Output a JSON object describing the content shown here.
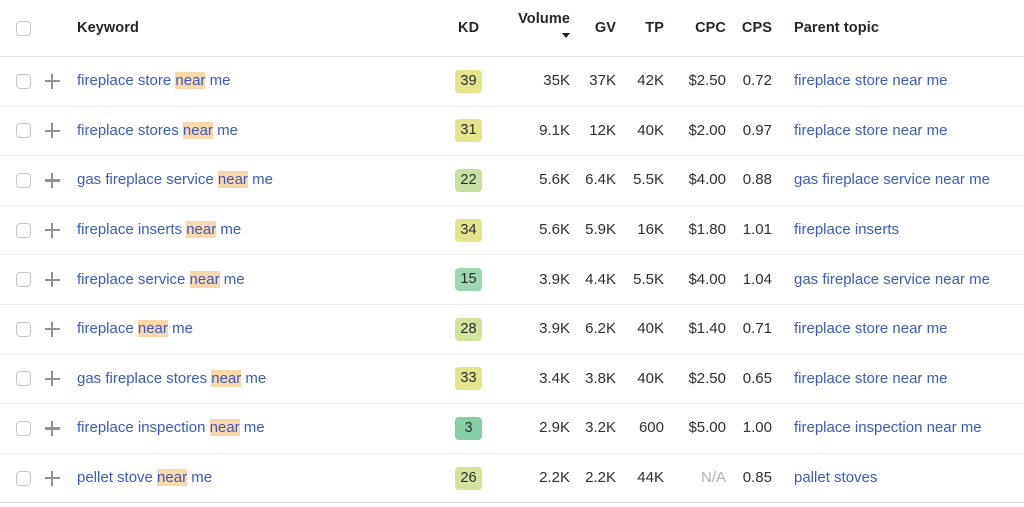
{
  "table": {
    "columns": [
      {
        "key": "keyword",
        "label": "Keyword"
      },
      {
        "key": "kd",
        "label": "KD"
      },
      {
        "key": "volume",
        "label": "Volume",
        "sorted": "desc"
      },
      {
        "key": "gv",
        "label": "GV"
      },
      {
        "key": "tp",
        "label": "TP"
      },
      {
        "key": "cpc",
        "label": "CPC"
      },
      {
        "key": "cps",
        "label": "CPS"
      },
      {
        "key": "parent_topic",
        "label": "Parent topic"
      }
    ],
    "header": {
      "keyword": "Keyword",
      "kd": "KD",
      "volume": "Volume",
      "gv": "GV",
      "tp": "TP",
      "cpc": "CPC",
      "cps": "CPS",
      "parent_topic": "Parent topic"
    },
    "highlight_term": "near",
    "colors": {
      "link": "#3b5bbd",
      "highlight": "#fad8ae",
      "kd_easy": "#85cfa4",
      "kd_medium": "#c4dfa0",
      "kd_hard": "#e4e48a",
      "row_divider": "#efefef",
      "header_divider": "#e2e2e2"
    },
    "rows": [
      {
        "checked": false,
        "keyword_prefix": "fireplace store ",
        "keyword_highlight": "near",
        "keyword_suffix": " me",
        "keyword_full": "fireplace store near me",
        "kd": "39",
        "kd_color": "#e4e48a",
        "volume": "35K",
        "gv": "37K",
        "tp": "42K",
        "cpc": "$2.50",
        "cps": "0.72",
        "parent_topic": "fireplace store near me"
      },
      {
        "checked": false,
        "keyword_prefix": "fireplace stores ",
        "keyword_highlight": "near",
        "keyword_suffix": " me",
        "keyword_full": "fireplace stores near me",
        "kd": "31",
        "kd_color": "#e4e48a",
        "volume": "9.1K",
        "gv": "12K",
        "tp": "40K",
        "cpc": "$2.00",
        "cps": "0.97",
        "parent_topic": "fireplace store near me"
      },
      {
        "checked": false,
        "keyword_prefix": "gas fireplace service ",
        "keyword_highlight": "near",
        "keyword_suffix": " me",
        "keyword_full": "gas fireplace service near me",
        "kd": "22",
        "kd_color": "#c8dfa2",
        "volume": "5.6K",
        "gv": "6.4K",
        "tp": "5.5K",
        "cpc": "$4.00",
        "cps": "0.88",
        "parent_topic": "gas fireplace service near me"
      },
      {
        "checked": false,
        "keyword_prefix": "fireplace inserts ",
        "keyword_highlight": "near",
        "keyword_suffix": " me",
        "keyword_full": "fireplace inserts near me",
        "kd": "34",
        "kd_color": "#e4e48a",
        "volume": "5.6K",
        "gv": "5.9K",
        "tp": "16K",
        "cpc": "$1.80",
        "cps": "1.01",
        "parent_topic": "fireplace inserts"
      },
      {
        "checked": false,
        "keyword_prefix": "fireplace service ",
        "keyword_highlight": "near",
        "keyword_suffix": " me",
        "keyword_full": "fireplace service near me",
        "kd": "15",
        "kd_color": "#9ed7af",
        "volume": "3.9K",
        "gv": "4.4K",
        "tp": "5.5K",
        "cpc": "$4.00",
        "cps": "1.04",
        "parent_topic": "gas fireplace service near me"
      },
      {
        "checked": false,
        "keyword_prefix": "fireplace ",
        "keyword_highlight": "near",
        "keyword_suffix": " me",
        "keyword_full": "fireplace near me",
        "kd": "28",
        "kd_color": "#d2e39b",
        "volume": "3.9K",
        "gv": "6.2K",
        "tp": "40K",
        "cpc": "$1.40",
        "cps": "0.71",
        "parent_topic": "fireplace store near me"
      },
      {
        "checked": false,
        "keyword_prefix": "gas fireplace stores ",
        "keyword_highlight": "near",
        "keyword_suffix": " me",
        "keyword_full": "gas fireplace stores near me",
        "kd": "33",
        "kd_color": "#e4e48a",
        "volume": "3.4K",
        "gv": "3.8K",
        "tp": "40K",
        "cpc": "$2.50",
        "cps": "0.65",
        "parent_topic": "fireplace store near me"
      },
      {
        "checked": false,
        "keyword_prefix": "fireplace inspection ",
        "keyword_highlight": "near",
        "keyword_suffix": " me",
        "keyword_full": "fireplace inspection near me",
        "kd": "3",
        "kd_color": "#85cfa4",
        "volume": "2.9K",
        "gv": "3.2K",
        "tp": "600",
        "cpc": "$5.00",
        "cps": "1.00",
        "parent_topic": "fireplace inspection near me"
      },
      {
        "checked": false,
        "keyword_prefix": "pellet stove ",
        "keyword_highlight": "near",
        "keyword_suffix": " me",
        "keyword_full": "pellet stove near me",
        "kd": "26",
        "kd_color": "#d2e39b",
        "volume": "2.2K",
        "gv": "2.2K",
        "tp": "44K",
        "cpc": "N/A",
        "cpc_na": true,
        "cps": "0.85",
        "parent_topic": "pallet stoves"
      }
    ]
  }
}
